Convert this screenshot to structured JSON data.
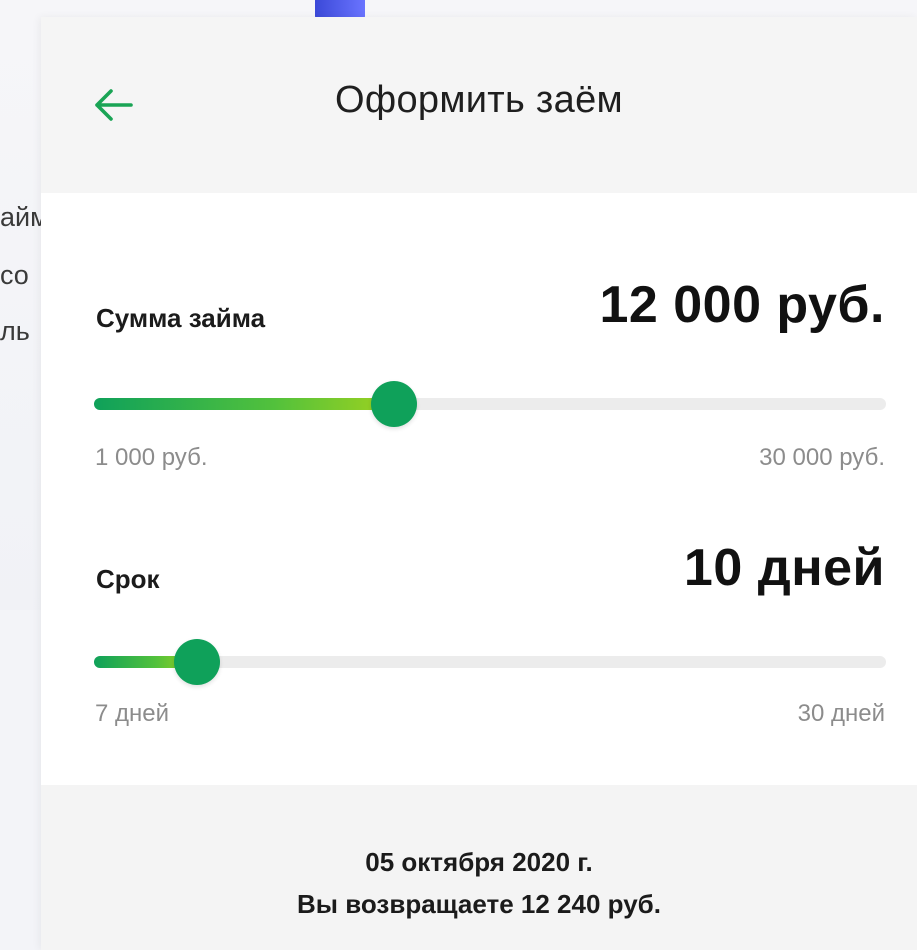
{
  "background": {
    "text_lines": [
      "айм",
      "со",
      "ль"
    ]
  },
  "header": {
    "title": "Оформить заём",
    "back_icon": "arrow-left-icon",
    "accent_color": "#1aa455"
  },
  "loan_amount": {
    "label": "Сумма займа",
    "value_text": "12 000 руб.",
    "min_label": "1 000 руб.",
    "max_label": "30 000 руб.",
    "value": 12000,
    "min": 1000,
    "max": 30000
  },
  "term": {
    "label": "Срок",
    "value_text": "10 дней",
    "min_label": "7 дней",
    "max_label": "30 дней",
    "value": 10,
    "min": 7,
    "max": 30
  },
  "summary": {
    "date": "05 октября 2020 г.",
    "return_text": "Вы возвращаете 12 240 руб."
  }
}
